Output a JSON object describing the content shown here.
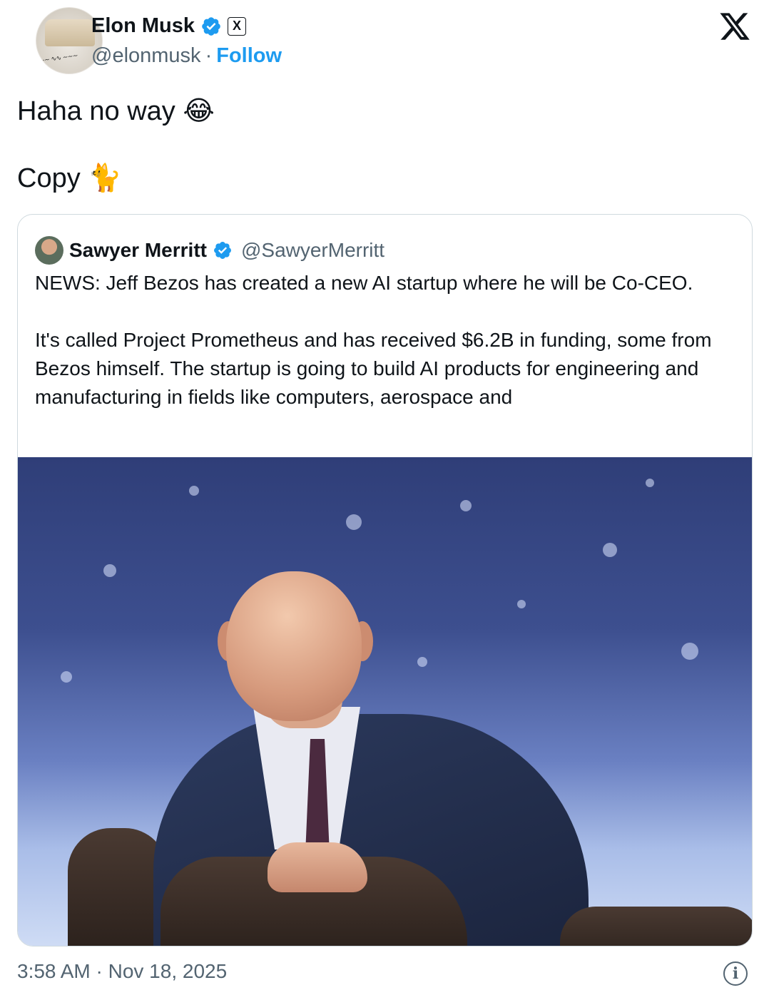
{
  "author": {
    "name": "Elon Musk",
    "handle": "@elonmusk",
    "separator": "·",
    "follow_label": "Follow",
    "avatar_icon": "avatar-photo",
    "badge_icon": "verified-badge-icon",
    "affiliate_badge": "X"
  },
  "tweet": {
    "line1": "Haha no way 😂",
    "line2": "Copy 🐈"
  },
  "quoted": {
    "name": "Sawyer Merritt",
    "handle": "@SawyerMerritt",
    "paragraph1": "NEWS: Jeff Bezos has created a new AI startup where he will be Co-CEO.",
    "paragraph2": "It's called Project Prometheus and has received $6.2B in funding, some from Bezos himself. The startup is going to build AI products for engineering and manufacturing in fields like computers, aerospace and"
  },
  "footer": {
    "timestamp": "3:58 AM · Nov 18, 2025",
    "info_icon": "info-icon"
  },
  "colors": {
    "accent": "#1d9bf0",
    "text": "#0f1419",
    "secondary": "#536471",
    "border": "#cfd9de"
  }
}
